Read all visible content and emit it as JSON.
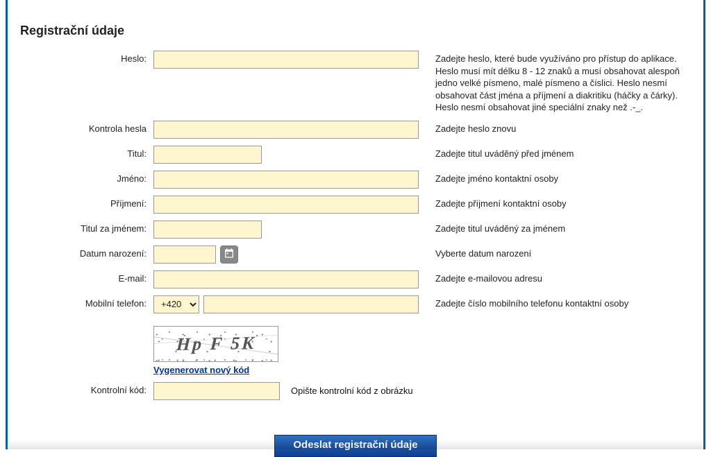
{
  "section_title": "Registrační údaje",
  "rows": {
    "heslo": {
      "label": "Heslo:",
      "hint": "Zadejte heslo, které bude využíváno pro přístup do aplikace. Heslo musí mít délku 8 - 12 znaků a musí obsahovat alespoň jedno velké písmeno, malé písmeno a číslici. Heslo nesmí obsahovat část jména a příjmení a diakritiku (háčky a čárky). Heslo nesmí obsahovat jiné speciální znaky než .-_."
    },
    "heslo2": {
      "label": "Kontrola hesla",
      "hint": "Zadejte heslo znovu"
    },
    "titul": {
      "label": "Titul:",
      "hint": "Zadejte titul uváděný před jménem"
    },
    "jmeno": {
      "label": "Jméno:",
      "hint": "Zadejte jméno kontaktní osoby"
    },
    "prijmeni": {
      "label": "Příjmení:",
      "hint": "Zadejte příjmení kontaktní osoby"
    },
    "titul_za": {
      "label": "Titul za jménem:",
      "hint": "Zadejte titul uváděný za jménem"
    },
    "datum": {
      "label": "Datum narození:",
      "hint": "Vyberte datum narození"
    },
    "email": {
      "label": "E-mail:",
      "hint": "Zadejte e-mailovou adresu"
    },
    "telefon": {
      "label": "Mobilní telefon:",
      "hint": "Zadejte číslo mobilního telefonu kontaktní osoby",
      "prefix": "+420"
    },
    "kod": {
      "label": "Kontrolní kód:",
      "hint": "Opište kontrolní kód z obrázku"
    }
  },
  "captcha": {
    "text": "Hp F 5K",
    "regen_label": "Vygenerovat nový kód"
  },
  "submit_label": "Odeslat registrační údaje"
}
